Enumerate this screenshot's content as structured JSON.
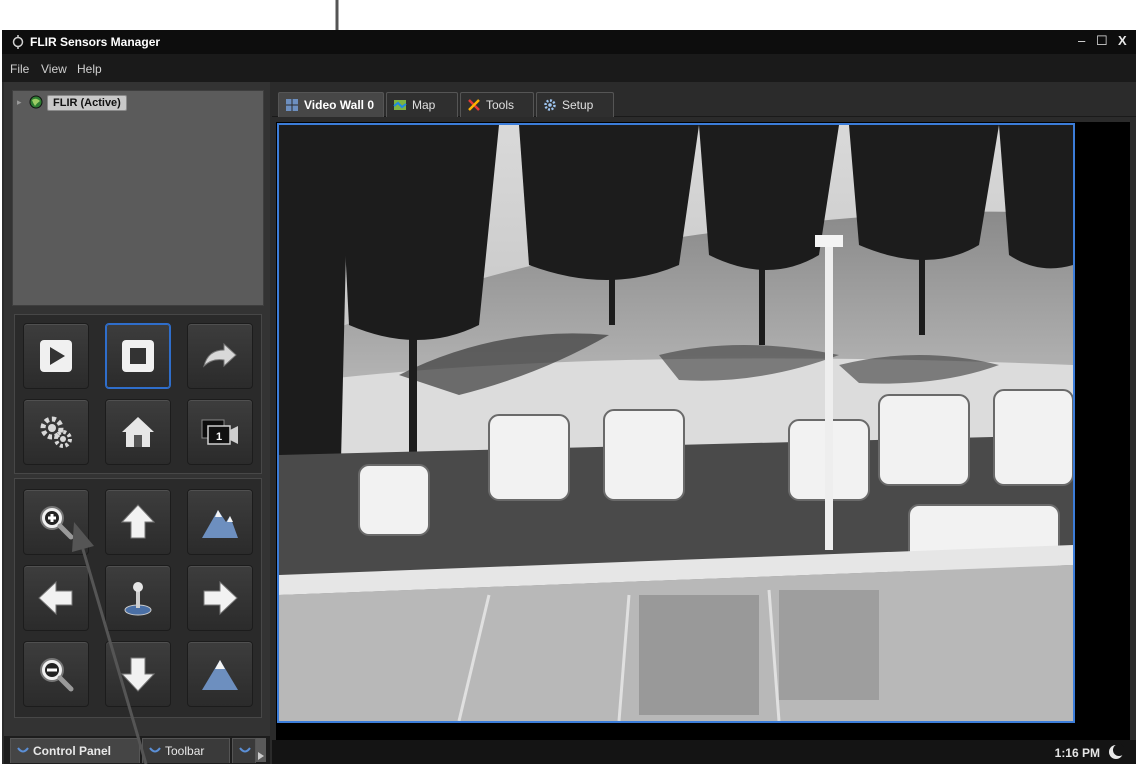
{
  "window": {
    "title": "FLIR Sensors Manager"
  },
  "window_controls": {
    "minimize": "–",
    "maximize": "☐",
    "close": "X"
  },
  "menu": [
    "File",
    "View",
    "Help"
  ],
  "tree": {
    "root_label": "FLIR (Active)"
  },
  "control_panel": {
    "playback_buttons": [
      "play-icon",
      "stop-icon",
      "forward-arrow-icon",
      "settings-gears-icon",
      "home-icon",
      "camera-1-icon"
    ],
    "ptz_buttons": [
      "zoom-in-icon",
      "tilt-up-icon",
      "focus-far-icon",
      "pan-left-icon",
      "joystick-icon",
      "pan-right-icon",
      "zoom-out-icon",
      "tilt-down-icon",
      "focus-near-icon"
    ]
  },
  "bottom_tabs": [
    {
      "label": "Control Panel",
      "active": true
    },
    {
      "label": "Toolbar",
      "active": false
    }
  ],
  "tabs": [
    {
      "label": "Video Wall 0",
      "icon": "video-wall-icon",
      "active": true
    },
    {
      "label": "Map",
      "icon": "map-icon",
      "active": false
    },
    {
      "label": "Tools",
      "icon": "tools-icon",
      "active": false
    },
    {
      "label": "Setup",
      "icon": "setup-icon",
      "active": false
    }
  ],
  "video": {
    "feed": "thermal camera feed (parking lot)"
  },
  "status": {
    "time": "1:16 PM"
  },
  "colors": {
    "accent": "#3c7dd9",
    "background": "#2b2b2b",
    "titlebar": "#0d0d0d"
  }
}
